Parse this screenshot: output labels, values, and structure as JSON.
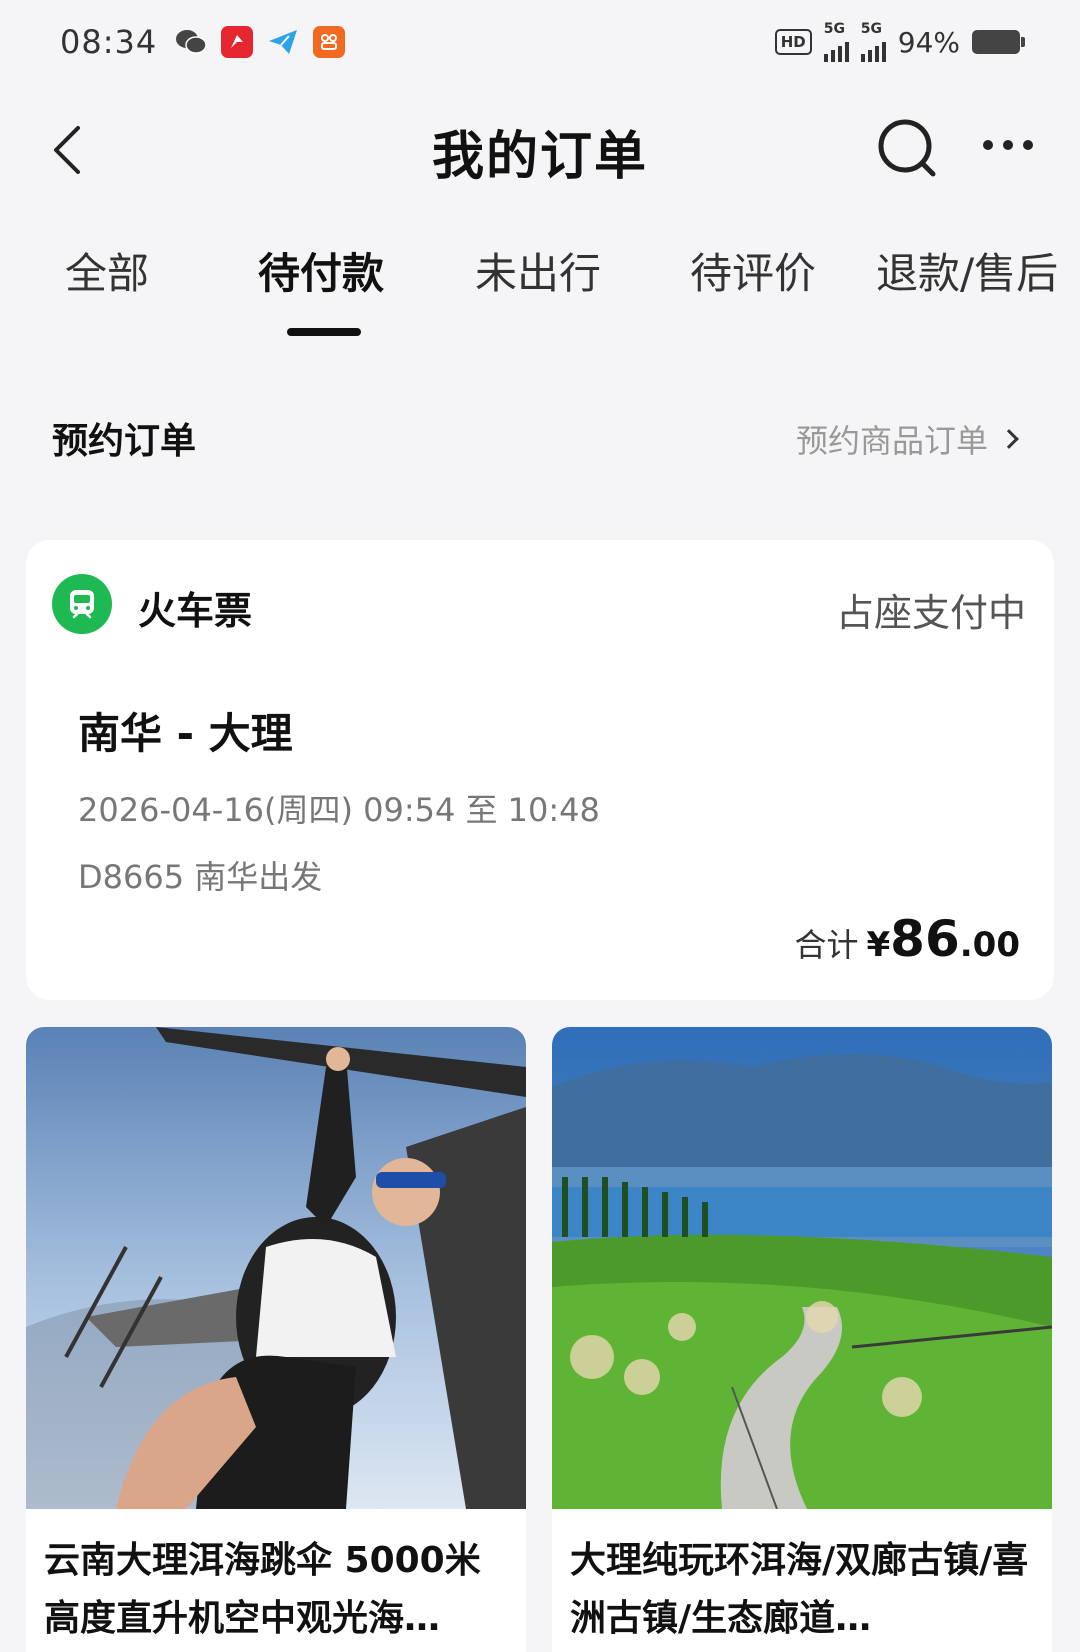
{
  "status_bar": {
    "time": "08:34",
    "hd_label": "HD",
    "network_1": "5G",
    "network_2": "5G",
    "battery": "94%",
    "notification_icons": [
      "wechat-icon",
      "app-red-icon",
      "telegram-icon",
      "app-orange-icon"
    ]
  },
  "nav": {
    "title": "我的订单"
  },
  "tabs": [
    {
      "label": "全部",
      "active": false
    },
    {
      "label": "待付款",
      "active": true
    },
    {
      "label": "未出行",
      "active": false
    },
    {
      "label": "待评价",
      "active": false
    },
    {
      "label": "退款/售后",
      "active": false
    }
  ],
  "section": {
    "title": "预约订单",
    "link": "预约商品订单"
  },
  "order": {
    "category": "火车票",
    "status": "占座支付中",
    "route": "南华 - 大理",
    "time": "2026-04-16(周四) 09:54 至 10:48",
    "train": "D8665 南华出发",
    "total_label": "合计",
    "currency": "¥",
    "amount_int": "86",
    "amount_dec": ".00"
  },
  "products": [
    {
      "title": "云南大理洱海跳伞 5000米高度直升机空中观光海…"
    },
    {
      "title": "大理纯玩环洱海/双廊古镇/喜洲古镇/生态廊道…"
    }
  ],
  "colors": {
    "accent_green": "#1fb954",
    "background": "#f5f5f7",
    "text_primary": "#111111",
    "text_secondary": "#777777"
  }
}
